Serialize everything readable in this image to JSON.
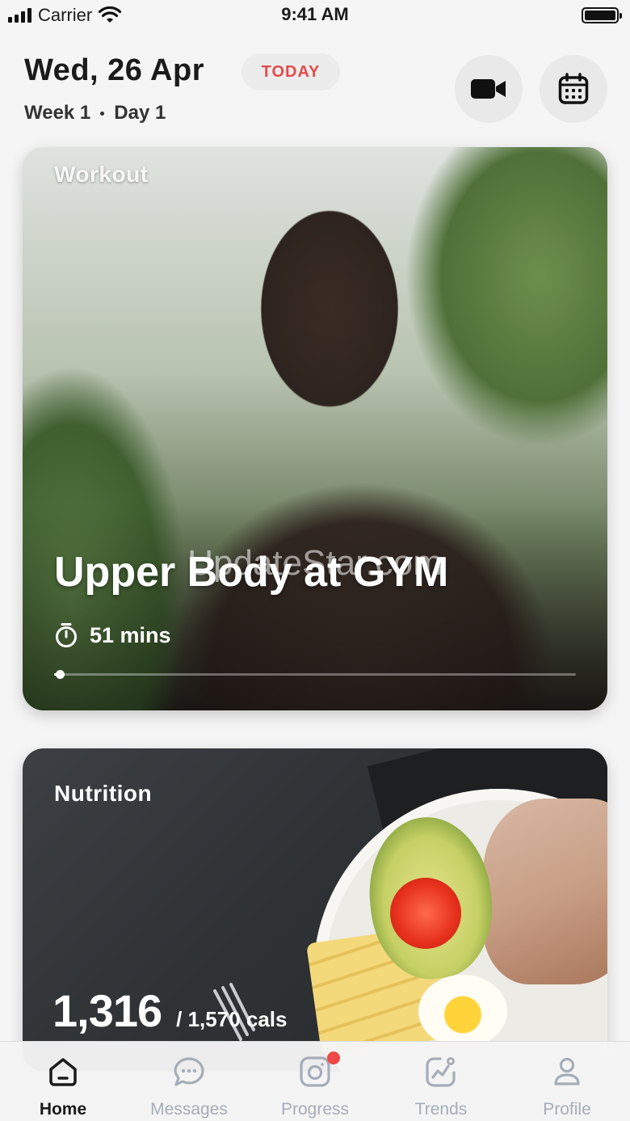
{
  "status_bar": {
    "carrier": "Carrier",
    "time": "9:41 AM"
  },
  "header": {
    "date": "Wed, 26 Apr",
    "today_badge": "TODAY",
    "week": "Week 1",
    "day": "Day 1",
    "buttons": {
      "video_icon": "video-camera-icon",
      "calendar_icon": "calendar-icon"
    }
  },
  "workout": {
    "label": "Workout",
    "title": "Upper Body at GYM",
    "duration": "51 mins",
    "progress": 0.01
  },
  "nutrition": {
    "label": "Nutrition",
    "calories_consumed": "1,316",
    "calories_target": "/ 1,570 cals"
  },
  "watermark": "UpdateStar.com",
  "tab_bar": {
    "tabs": [
      {
        "label": "Home",
        "icon": "home-icon",
        "active": true
      },
      {
        "label": "Messages",
        "icon": "chat-bubble-icon",
        "active": false
      },
      {
        "label": "Progress",
        "icon": "camera-icon",
        "active": false,
        "notification": true
      },
      {
        "label": "Trends",
        "icon": "trend-chart-icon",
        "active": false
      },
      {
        "label": "Profile",
        "icon": "person-icon",
        "active": false
      }
    ]
  },
  "colors": {
    "accent_red": "#e24b4b",
    "notification_dot": "#ef4848",
    "tab_inactive": "#a5adb8"
  }
}
